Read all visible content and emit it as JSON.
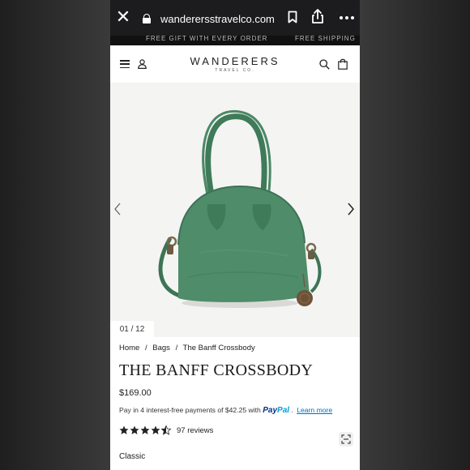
{
  "browser": {
    "url": "wanderersstravelco.com",
    "close_icon": "close-icon",
    "lock_icon": "lock-icon",
    "bookmark_icon": "bookmark-icon",
    "share_icon": "share-icon",
    "more_icon": "more-icon"
  },
  "promo": {
    "left_text": "FREE GIFT WITH EVERY ORDER",
    "right_text": "FREE SHIPPING"
  },
  "header": {
    "logo_main": "WANDERERS",
    "logo_sub": "TRAVEL CO."
  },
  "gallery": {
    "current": "01",
    "separator": "/",
    "total": "12",
    "accent": "#4e8a67"
  },
  "breadcrumb": {
    "items": [
      "Home",
      "/",
      "Bags",
      "/",
      "The Banff Crossbody"
    ]
  },
  "product": {
    "title": "THE BANFF CROSSBODY",
    "price": "$169.00",
    "paypal_text": "Pay in 4 interest-free payments of $42.25 with",
    "paypal_brand_1": "Pay",
    "paypal_brand_2": "Pal",
    "paypal_dot": ".",
    "learn_more": "Learn more",
    "rating": 4.5,
    "reviews": "97 reviews",
    "variant": "Classic"
  }
}
